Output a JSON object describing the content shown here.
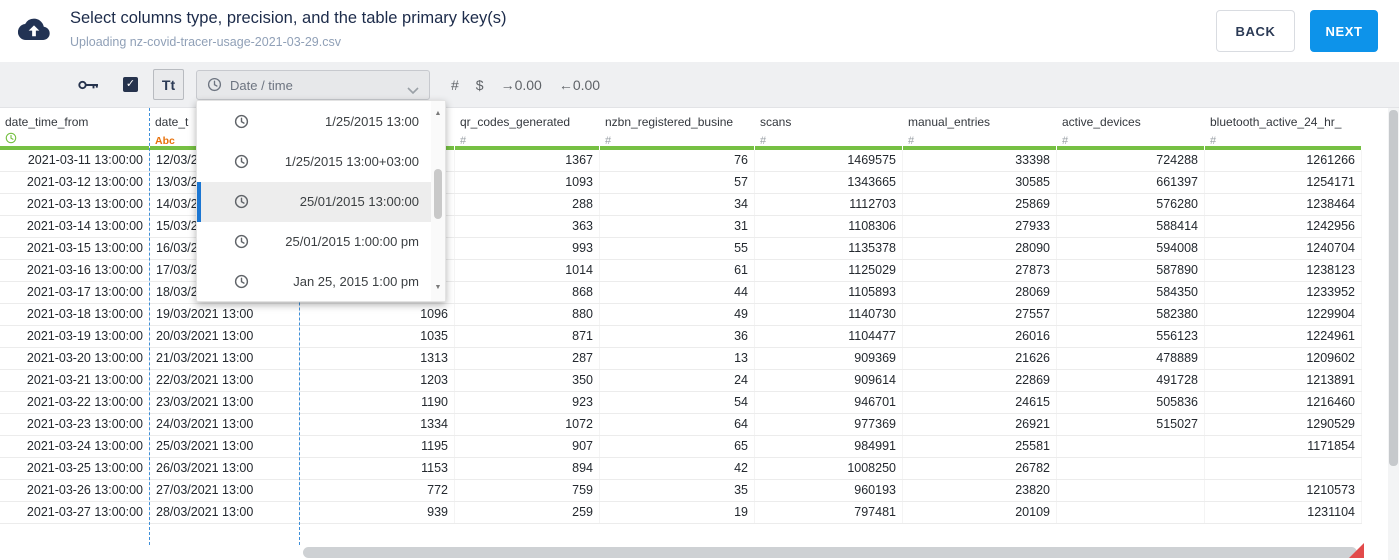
{
  "header": {
    "title": "Select columns type, precision, and the table primary key(s)",
    "subtitle": "Uploading nz-covid-tracer-usage-2021-03-29.csv",
    "back_label": "BACK",
    "next_label": "NEXT"
  },
  "toolbar": {
    "text_type_label": "Tt",
    "type_select": {
      "value": "Date / time"
    },
    "format_buttons": [
      {
        "name": "number-format",
        "label": "#"
      },
      {
        "name": "currency-format",
        "label": "$"
      },
      {
        "name": "increase-decimal",
        "label": "→0.00"
      },
      {
        "name": "decrease-decimal",
        "label": "←0.00"
      }
    ]
  },
  "dropdown": {
    "options": [
      {
        "label": "1/25/2015 13:00",
        "selected": false
      },
      {
        "label": "1/25/2015 13:00+03:00",
        "selected": false
      },
      {
        "label": "25/01/2015 13:00:00",
        "selected": true
      },
      {
        "label": "25/01/2015 1:00:00 pm",
        "selected": false
      },
      {
        "label": "Jan 25, 2015 1:00 pm",
        "selected": false
      }
    ]
  },
  "table": {
    "columns": [
      {
        "label": "date_time_from",
        "type": "datetime",
        "type_label": ""
      },
      {
        "label": "date_t",
        "type": "text",
        "type_label": "Abc"
      },
      {
        "label": "",
        "type": "hidden",
        "type_label": ""
      },
      {
        "label": "qr_codes_generated",
        "type": "number",
        "type_label": "#"
      },
      {
        "label": "nzbn_registered_busine",
        "type": "number",
        "type_label": "#"
      },
      {
        "label": "scans",
        "type": "number",
        "type_label": "#"
      },
      {
        "label": "manual_entries",
        "type": "number",
        "type_label": "#"
      },
      {
        "label": "active_devices",
        "type": "number",
        "type_label": "#"
      },
      {
        "label": "bluetooth_active_24_hr_",
        "type": "number",
        "type_label": "#"
      }
    ],
    "rows": [
      [
        "2021-03-11 13:00:00",
        "12/03/2",
        "",
        "1367",
        "76",
        "1469575",
        "33398",
        "724288",
        "1261266"
      ],
      [
        "2021-03-12 13:00:00",
        "13/03/2",
        "",
        "1093",
        "57",
        "1343665",
        "30585",
        "661397",
        "1254171"
      ],
      [
        "2021-03-13 13:00:00",
        "14/03/2",
        "",
        "288",
        "34",
        "1112703",
        "25869",
        "576280",
        "1238464"
      ],
      [
        "2021-03-14 13:00:00",
        "15/03/2",
        "",
        "363",
        "31",
        "1108306",
        "27933",
        "588414",
        "1242956"
      ],
      [
        "2021-03-15 13:00:00",
        "16/03/2",
        "",
        "993",
        "55",
        "1135378",
        "28090",
        "594008",
        "1240704"
      ],
      [
        "2021-03-16 13:00:00",
        "17/03/2",
        "",
        "1014",
        "61",
        "1125029",
        "27873",
        "587890",
        "1238123"
      ],
      [
        "2021-03-17 13:00:00",
        "18/03/2",
        "",
        "868",
        "44",
        "1105893",
        "28069",
        "584350",
        "1233952"
      ],
      [
        "2021-03-18 13:00:00",
        "19/03/2021 13:00",
        "1096",
        "880",
        "49",
        "1140730",
        "27557",
        "582380",
        "1229904"
      ],
      [
        "2021-03-19 13:00:00",
        "20/03/2021 13:00",
        "1035",
        "871",
        "36",
        "1104477",
        "26016",
        "556123",
        "1224961"
      ],
      [
        "2021-03-20 13:00:00",
        "21/03/2021 13:00",
        "1313",
        "287",
        "13",
        "909369",
        "21626",
        "478889",
        "1209602"
      ],
      [
        "2021-03-21 13:00:00",
        "22/03/2021 13:00",
        "1203",
        "350",
        "24",
        "909614",
        "22869",
        "491728",
        "1213891"
      ],
      [
        "2021-03-22 13:00:00",
        "23/03/2021 13:00",
        "1190",
        "923",
        "54",
        "946701",
        "24615",
        "505836",
        "1216460"
      ],
      [
        "2021-03-23 13:00:00",
        "24/03/2021 13:00",
        "1334",
        "1072",
        "64",
        "977369",
        "26921",
        "515027",
        "1290529"
      ],
      [
        "2021-03-24 13:00:00",
        "25/03/2021 13:00",
        "1195",
        "907",
        "65",
        "984991",
        "25581",
        "",
        "1171854"
      ],
      [
        "2021-03-25 13:00:00",
        "26/03/2021 13:00",
        "1153",
        "894",
        "42",
        "1008250",
        "26782",
        "",
        ""
      ],
      [
        "2021-03-26 13:00:00",
        "27/03/2021 13:00",
        "772",
        "759",
        "35",
        "960193",
        "23820",
        "",
        "1210573"
      ],
      [
        "2021-03-27 13:00:00",
        "28/03/2021 13:00",
        "939",
        "259",
        "19",
        "797481",
        "20109",
        "",
        "1231104"
      ]
    ]
  },
  "icons": {
    "scroll_up": "▲",
    "scroll_down": "▼",
    "check": "✓"
  },
  "colors": {
    "accent_blue": "#0d93ea",
    "navy": "#26334d",
    "quality_green": "#76c043",
    "type_orange": "#e8710a",
    "selection_dash_blue": "#3f8fd8",
    "error_red": "#e24a4a"
  }
}
